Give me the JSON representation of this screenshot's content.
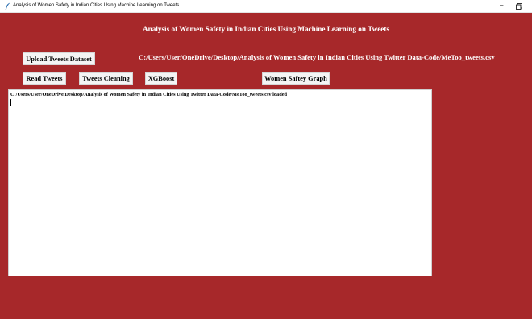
{
  "window": {
    "title": "Analysis of Women Safety in Indian Cities Using Machine Learning on Tweets",
    "minimize_glyph": "–",
    "icons": {
      "app": "feather-icon",
      "minimize": "minimize-icon",
      "restore": "restore-icon"
    }
  },
  "main": {
    "heading": "Analysis of Women Safety in Indian Cities Using Machine Learning on Tweets",
    "path_label": "C:/Users/User/OneDrive/Desktop/Analysis of Women Safety in Indian Cities Using Twitter Data-Code/MeToo_tweets.csv"
  },
  "buttons": {
    "upload": "Upload Tweets Dataset",
    "read": "Read Tweets",
    "cleaning": "Tweets Cleaning",
    "xgboost": "XGBoost",
    "graph": "Women Saftey Graph"
  },
  "output": {
    "text": "C:/Users/User/OneDrive/Desktop/Analysis of Women Safety in Indian Cities Using Twitter Data-Code/MeToo_tweets.csv loaded"
  },
  "colors": {
    "background": "#a7282a",
    "button": "#f4f4f4",
    "text_light": "#ffffff"
  }
}
